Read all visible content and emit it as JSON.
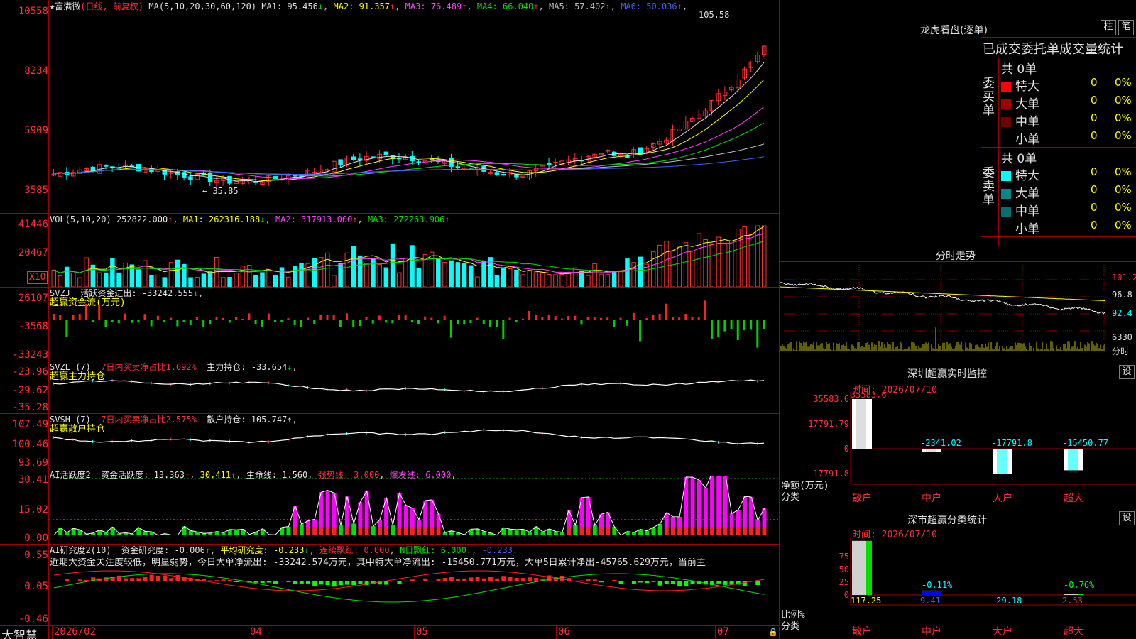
{
  "stock": {
    "title": "★富满微",
    "mode": "(日线, 前复权)",
    "ma_label": "MA(5,10,20,30,60,120)",
    "ma": [
      {
        "label": "MA1: 95.456",
        "arrow": "↓",
        "color": "#e0e0e0"
      },
      {
        "label": "MA2: 91.357",
        "arrow": "↑",
        "color": "#ffff00"
      },
      {
        "label": "MA3: 76.489",
        "arrow": "↑",
        "color": "#ff40ff"
      },
      {
        "label": "MA4: 66.040",
        "arrow": "↑",
        "color": "#00e000"
      },
      {
        "label": "MA5: 57.402",
        "arrow": "↑",
        "color": "#c0c0c0"
      },
      {
        "label": "MA6: 50.036",
        "arrow": "↑",
        "color": "#4060ff"
      }
    ],
    "high_label": "105.58",
    "low_label": "← 35.85",
    "y_ticks": [
      "10558",
      "8234",
      "5909",
      "3585"
    ]
  },
  "volume": {
    "label": "VOL(5,10,20)",
    "value": "252822.000",
    "ma1": "MA1: 262316.188",
    "ma2": "MA2: 317913.000",
    "ma3": "MA3: 272263.906",
    "y_ticks": [
      "41446",
      "20467"
    ],
    "unit": "X10"
  },
  "svzj": {
    "label": "SVZJ",
    "line": "活跃资金进出: -33242.555",
    "sub": "超赢资金流(万元)",
    "y_ticks": [
      "26107",
      "-3568",
      "-33243"
    ]
  },
  "svzl": {
    "label": "SVZL (7)",
    "ratio": "7日内买卖净占比1.692%",
    "hold": "主力持仓: -33.654",
    "sub": "超赢主力持仓",
    "y_ticks": [
      "-23.96",
      "-29.62",
      "-35.28"
    ]
  },
  "svsh": {
    "label": "SVSH (7)",
    "ratio": "7日内买卖净占比2.575%",
    "hold": "散户持仓: 105.747",
    "sub": "超赢散户持仓",
    "y_ticks": [
      "107.49",
      "100.46",
      "93.69"
    ]
  },
  "ai_active": {
    "label": "AI活跃度2",
    "a": "资金活跃度: 13.363",
    "b": "30.411",
    "c": "生命线: 1.560",
    "d": "强势线: 3.000",
    "e": "爆发线: 6.000",
    "y_ticks": [
      "30.41",
      "15.02",
      "0.00"
    ]
  },
  "ai_research": {
    "label": "AI研究度2(10)",
    "a": "资金研究度: -0.006",
    "b": "平均研究度: -0.233",
    "c": "连续飘红: 0.000",
    "d": "N日飘红: 6.000",
    "e": "-0.233",
    "comment": "近期大资金关注度较低，明显弱势，今日大单净流出: -33242.574万元，其中特大单净流出: -15450.771万元，大单5日累计净出-45765.629万元，当前主",
    "y_ticks": [
      "0.55",
      "0.05",
      "-0.46"
    ]
  },
  "xaxis": {
    "brand": "大智慧",
    "labels": [
      "2026/02",
      "04",
      "05",
      "06",
      "07"
    ]
  },
  "lhb": {
    "title": "龙虎看盘(逐单)",
    "btn_bar": "柱",
    "btn_pen": "笔",
    "header": "已成交委托单成交量统计",
    "buy_label": "委买单",
    "sell_label": "委卖单",
    "buy_total": "共 0单",
    "sell_total": "共 0单",
    "buy_rows": [
      {
        "name": "特大",
        "n": "0",
        "p": "0%",
        "color": "#ff0000"
      },
      {
        "name": "大单",
        "n": "0",
        "p": "0%",
        "color": "#a00000"
      },
      {
        "name": "中单",
        "n": "0",
        "p": "0%",
        "color": "#700000"
      },
      {
        "name": "小单",
        "n": "0",
        "p": "0%",
        "color": ""
      }
    ],
    "sell_rows": [
      {
        "name": "特大",
        "n": "0",
        "p": "0%",
        "color": "#00ffff"
      },
      {
        "name": "大单",
        "n": "0",
        "p": "0%",
        "color": "#008888"
      },
      {
        "name": "中单",
        "n": "0",
        "p": "0%",
        "color": "#007070"
      },
      {
        "name": "小单",
        "n": "0",
        "p": "0%",
        "color": ""
      }
    ]
  },
  "intraday": {
    "title": "分时走势",
    "ticks": [
      "101.2",
      "96.8",
      "92.4",
      "6330"
    ],
    "foot": "分时"
  },
  "monitor": {
    "title": "深圳超赢实时监控",
    "btn": "设",
    "time": "时间: 2026/07/10",
    "top_val": "35583.6",
    "y_ticks": [
      "35583.6",
      "17791.79",
      "-0",
      "-17791.8"
    ],
    "values": [
      "35583.6",
      "-2341.02",
      "-17791.8",
      "-15450.77"
    ],
    "unit": "净额(万元)",
    "cat_label": "分类",
    "cats": [
      "散户",
      "中户",
      "大户",
      "超大"
    ]
  },
  "classify": {
    "title": "深市超赢分类统计",
    "btn": "设",
    "time": "时间: 2026/07/10",
    "y_ticks": [
      "75",
      "50",
      "25",
      "0"
    ],
    "top_vals": [
      "",
      "-0.11%",
      "",
      "-0.76%"
    ],
    "bottom_vals": [
      "117.25",
      "9.41",
      "-29.18",
      "2.53"
    ],
    "unit": "比例%",
    "cat_label": "分类",
    "cats": [
      "散户",
      "中户",
      "大户",
      "超大"
    ]
  },
  "colors": {
    "up": "#ff3030",
    "down": "#00ffff",
    "grid": "#a00000"
  }
}
